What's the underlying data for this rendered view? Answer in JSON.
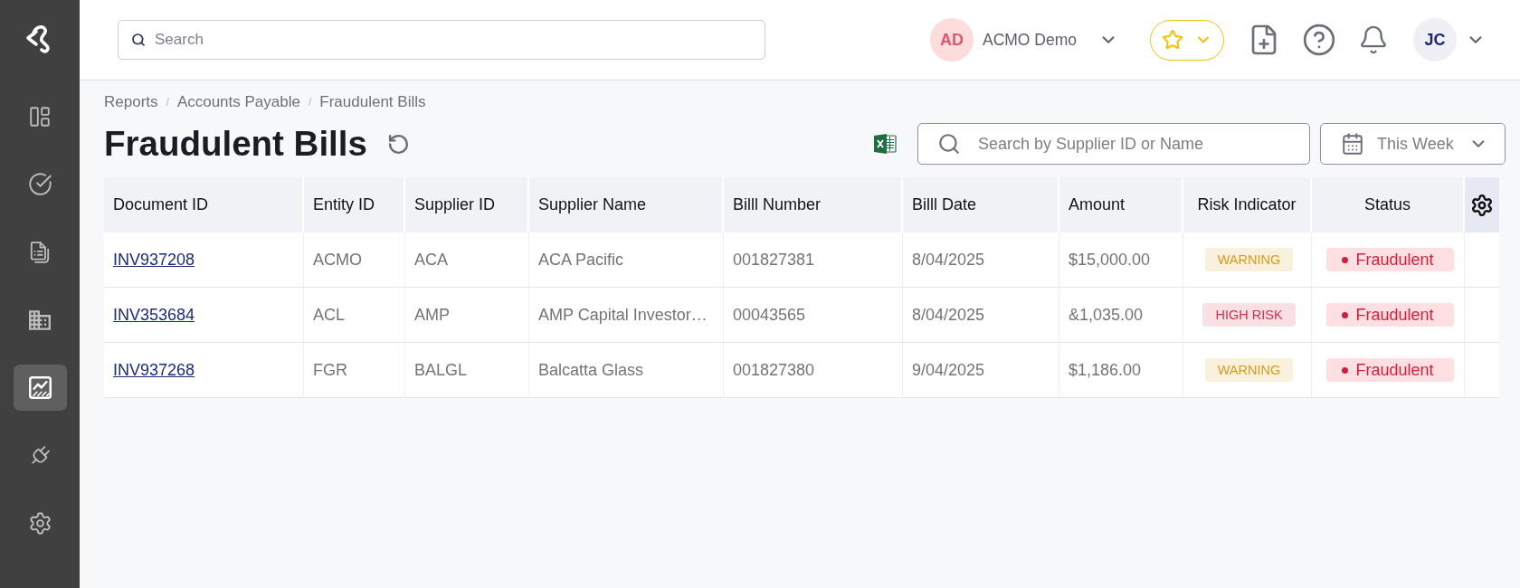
{
  "sidebar": {
    "items": [
      {
        "selected": false
      },
      {
        "selected": false
      },
      {
        "selected": false
      },
      {
        "selected": false
      },
      {
        "selected": true
      },
      {
        "selected": false
      },
      {
        "selected": false
      }
    ]
  },
  "topbar": {
    "search": {
      "placeholder": "Search"
    },
    "organization": {
      "initials": "AD",
      "name": "ACMO Demo"
    },
    "user": {
      "initials": "JC"
    }
  },
  "breadcrumb": {
    "separator": "/",
    "items": [
      "Reports",
      "Accounts Payable",
      "Fraudulent Bills"
    ]
  },
  "title": "Fraudulent Bills",
  "filters": {
    "search": {
      "placeholder": "Search by Supplier ID or Name"
    },
    "period": {
      "value": "This Week"
    }
  },
  "table": {
    "columns": [
      "Document ID",
      "Entity ID",
      "Supplier ID",
      "Supplier Name",
      "Billl Number",
      "Billl Date",
      "Amount",
      "Risk Indicator",
      "Status"
    ],
    "rows": [
      {
        "document_id": "INV937208",
        "entity_id": "ACMO",
        "supplier_id": "ACA",
        "supplier_name": "ACA Pacific",
        "bill_number": "001827381",
        "bill_date": "8/04/2025",
        "amount": "$15,000.00",
        "risk": {
          "label": "WARNING",
          "color": "#d99a1a"
        },
        "status": "Fraudulent"
      },
      {
        "document_id": "INV353684",
        "entity_id": "ACL",
        "supplier_id": "AMP",
        "supplier_name": "AMP Capital Investor…",
        "bill_number": "00043565",
        "bill_date": "8/04/2025",
        "amount": "&1,035.00",
        "risk": {
          "label": "HIGH RISK",
          "color": "#d32f4b"
        },
        "status": "Fraudulent"
      },
      {
        "document_id": "INV937268",
        "entity_id": "FGR",
        "supplier_id": "BALGL",
        "supplier_name": "Balcatta Glass",
        "bill_number": "001827380",
        "bill_date": "9/04/2025",
        "amount": "$1,186.00",
        "risk": {
          "label": "WARNING",
          "color": "#d99a1a"
        },
        "status": "Fraudulent"
      }
    ]
  }
}
